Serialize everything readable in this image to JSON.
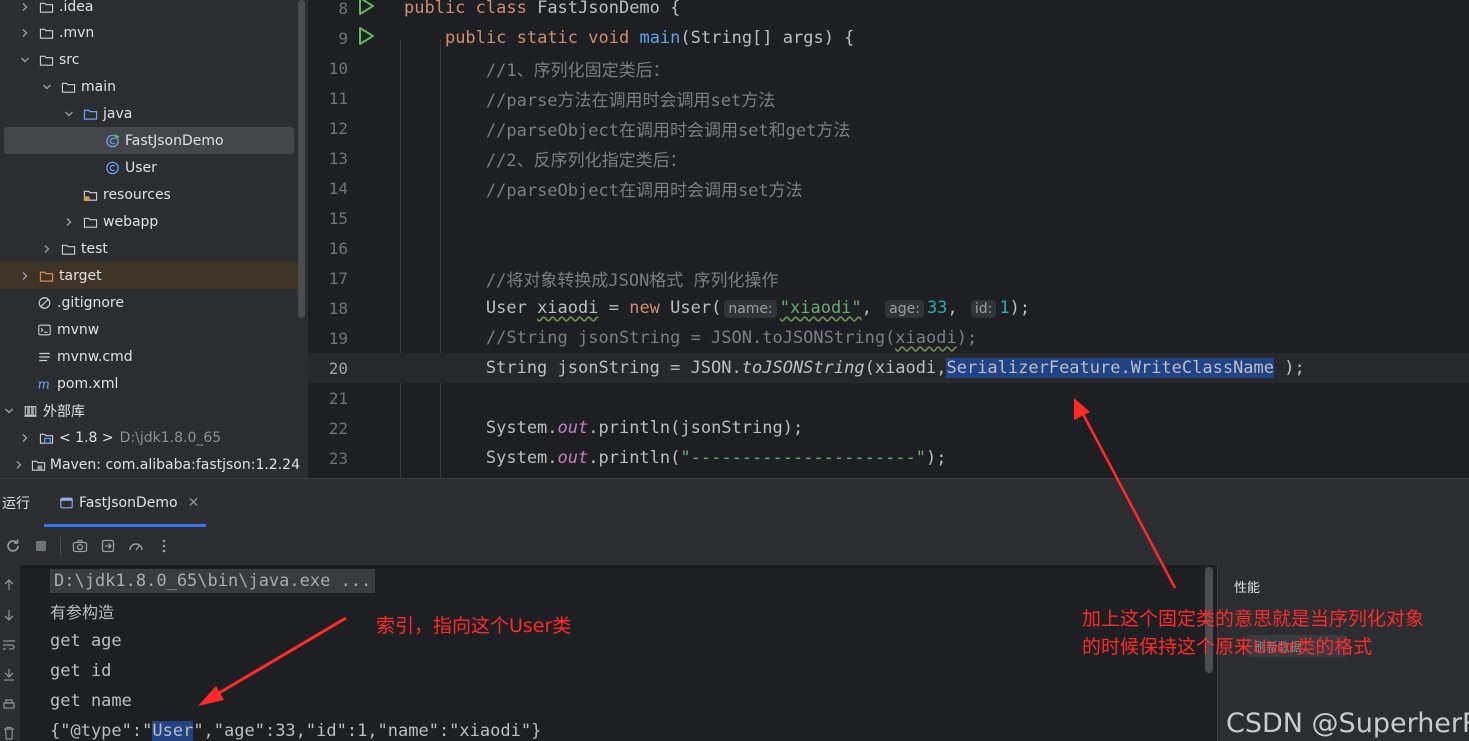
{
  "colors": {
    "accent": "#3574f0",
    "annotation": "#ff2a2a",
    "selection": "#214283"
  },
  "tree": {
    "items": [
      {
        "label": ".idea",
        "icon": "folder-icon",
        "expanded": false
      },
      {
        "label": ".mvn",
        "icon": "folder-icon",
        "expanded": false
      },
      {
        "label": "src",
        "icon": "folder-icon",
        "expanded": true
      },
      {
        "label": "main",
        "icon": "folder-icon",
        "expanded": true
      },
      {
        "label": "java",
        "icon": "source-folder-icon",
        "expanded": true
      },
      {
        "label": "FastJsonDemo",
        "icon": "java-class-runnable-icon",
        "selected": true
      },
      {
        "label": "User",
        "icon": "java-class-icon"
      },
      {
        "label": "resources",
        "icon": "resources-folder-icon"
      },
      {
        "label": "webapp",
        "icon": "folder-icon",
        "expanded": false
      },
      {
        "label": "test",
        "icon": "folder-icon",
        "expanded": false
      },
      {
        "label": "target",
        "icon": "excluded-folder-icon",
        "expanded": false
      },
      {
        "label": ".gitignore",
        "icon": "ignore-file-icon"
      },
      {
        "label": "mvnw",
        "icon": "shell-file-icon"
      },
      {
        "label": "mvnw.cmd",
        "icon": "text-file-icon"
      },
      {
        "label": "pom.xml",
        "icon": "maven-icon"
      },
      {
        "label": "外部库",
        "icon": "library-icon",
        "expanded": true
      },
      {
        "label": "< 1.8 >",
        "extra": "D:\\jdk1.8.0_65",
        "icon": "jdk-icon",
        "expanded": false
      },
      {
        "label": "Maven: com.alibaba:fastjson:1.2.24",
        "icon": "library-jar-icon",
        "expanded": false
      }
    ]
  },
  "editor": {
    "current_line": 20,
    "lines": [
      {
        "n": "8",
        "run": true,
        "tokens": [
          [
            "kw",
            "public "
          ],
          [
            "kw",
            "class "
          ],
          [
            "",
            "FastJsonDemo {"
          ]
        ]
      },
      {
        "n": "9",
        "run": true,
        "tokens": [
          [
            "",
            "    "
          ],
          [
            "kw",
            "public "
          ],
          [
            "kw",
            "static "
          ],
          [
            "kw",
            "void "
          ],
          [
            "fn",
            "main"
          ],
          [
            "",
            "(String[] args) {"
          ]
        ]
      },
      {
        "n": "10",
        "tokens": [
          [
            "",
            "        "
          ],
          [
            "cm",
            "//1、序列化固定类后："
          ]
        ]
      },
      {
        "n": "11",
        "tokens": [
          [
            "",
            "        "
          ],
          [
            "cm",
            "//parse方法在调用时会调用set方法"
          ]
        ]
      },
      {
        "n": "12",
        "tokens": [
          [
            "",
            "        "
          ],
          [
            "cm",
            "//parseObject在调用时会调用set和get方法"
          ]
        ]
      },
      {
        "n": "13",
        "tokens": [
          [
            "",
            "        "
          ],
          [
            "cm",
            "//2、反序列化指定类后："
          ]
        ]
      },
      {
        "n": "14",
        "tokens": [
          [
            "",
            "        "
          ],
          [
            "cm",
            "//parseObject在调用时会调用set方法"
          ]
        ]
      },
      {
        "n": "15",
        "tokens": []
      },
      {
        "n": "16",
        "tokens": []
      },
      {
        "n": "17",
        "tokens": [
          [
            "",
            "        "
          ],
          [
            "cm",
            "//将对象转换成JSON格式 序列化操作"
          ]
        ]
      },
      {
        "n": "18",
        "tokens": [
          [
            "",
            "        User "
          ],
          [
            "wavy",
            "xiaodi"
          ],
          [
            "",
            " = "
          ],
          [
            "kw",
            "new "
          ],
          [
            "",
            "User("
          ],
          [
            "hint",
            "name:"
          ],
          [
            "str wavy",
            "\"xiaodi\""
          ],
          [
            "",
            ", "
          ],
          [
            "hint",
            "age:"
          ],
          [
            "num",
            "33"
          ],
          [
            "",
            ", "
          ],
          [
            "hint",
            "id:"
          ],
          [
            "num",
            "1"
          ],
          [
            "",
            ");"
          ]
        ]
      },
      {
        "n": "19",
        "tokens": [
          [
            "",
            "        "
          ],
          [
            "cm",
            "//String jsonString = JSON.toJSONString("
          ],
          [
            "cm wavy",
            "xiaodi"
          ],
          [
            "cm",
            ");"
          ]
        ]
      },
      {
        "n": "20",
        "tokens": [
          [
            "",
            "        String jsonString = JSON."
          ],
          [
            "it",
            "toJSONString"
          ],
          [
            "",
            "(xiaodi,"
          ],
          [
            "sel",
            "SerializerFeature."
          ],
          [
            "sel it2",
            "WriteClassName"
          ],
          [
            "",
            " );"
          ]
        ]
      },
      {
        "n": "21",
        "tokens": []
      },
      {
        "n": "22",
        "tokens": [
          [
            "",
            "        System."
          ],
          [
            "field",
            "out"
          ],
          [
            "",
            ".println(jsonString);"
          ]
        ]
      },
      {
        "n": "23",
        "tokens": [
          [
            "",
            "        System."
          ],
          [
            "field",
            "out"
          ],
          [
            "",
            ".println("
          ],
          [
            "str",
            "\"----------------------\""
          ],
          [
            "",
            ");"
          ]
        ]
      }
    ]
  },
  "run": {
    "title": "运行",
    "tab_label": "FastJsonDemo",
    "console": {
      "command": "D:\\jdk1.8.0_65\\bin\\java.exe ...",
      "lines": [
        "有参构造",
        "get age",
        "get id",
        "get name"
      ],
      "json_prefix": "{\"@type\":\"",
      "json_type": "User",
      "json_suffix": "\",\"age\":33,\"id\":1,\"name\":\"xiaodi\"}"
    },
    "perf_title": "性能",
    "perf_chip": "刷新数据"
  },
  "annotations": {
    "index_note": "索引，指向这个User类",
    "feature_note_line1": "加上这个固定类的意思就是当序列化对象",
    "feature_note_line2": "的时候保持这个原来User类的格式"
  },
  "watermark": "CSDN @SuperherRo"
}
